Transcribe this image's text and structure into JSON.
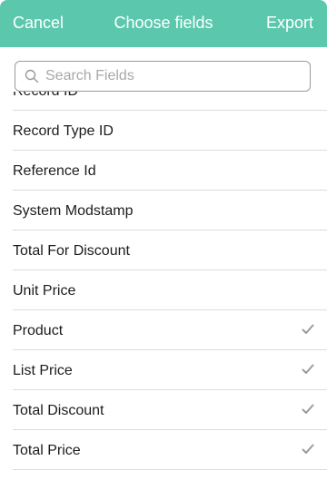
{
  "header": {
    "cancel_label": "Cancel",
    "title": "Choose fields",
    "export_label": "Export"
  },
  "search": {
    "placeholder": "Search Fields",
    "value": ""
  },
  "fields": [
    {
      "label": "Record ID",
      "selected": false
    },
    {
      "label": "Record Type ID",
      "selected": false
    },
    {
      "label": "Reference Id",
      "selected": false
    },
    {
      "label": "System Modstamp",
      "selected": false
    },
    {
      "label": "Total For Discount",
      "selected": false
    },
    {
      "label": "Unit Price",
      "selected": false
    },
    {
      "label": "Product",
      "selected": true
    },
    {
      "label": "List Price",
      "selected": true
    },
    {
      "label": "Total Discount",
      "selected": true
    },
    {
      "label": "Total Price",
      "selected": true
    }
  ],
  "colors": {
    "accent": "#5bc8ae",
    "check": "#9a9a9a",
    "divider": "#dcdcdc"
  },
  "icons": {
    "search": "search-icon",
    "check": "checkmark-icon"
  }
}
